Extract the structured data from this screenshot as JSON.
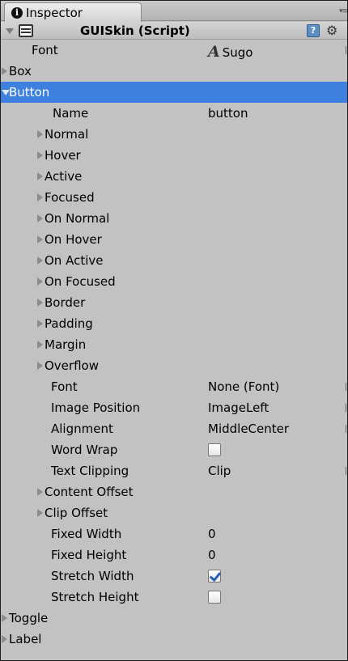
{
  "tab": {
    "label": "Inspector"
  },
  "header": {
    "title": "GUISkin (Script)"
  },
  "font": {
    "label": "Font",
    "value": "Sugo"
  },
  "sections": {
    "box": "Box",
    "button": "Button",
    "toggle": "Toggle",
    "label": "Label"
  },
  "button": {
    "name_label": "Name",
    "name_value": "button",
    "states": [
      "Normal",
      "Hover",
      "Active",
      "Focused",
      "On Normal",
      "On Hover",
      "On Active",
      "On Focused",
      "Border",
      "Padding",
      "Margin",
      "Overflow"
    ],
    "font_label": "Font",
    "font_value": "None (Font)",
    "image_position_label": "Image Position",
    "image_position_value": "ImageLeft",
    "alignment_label": "Alignment",
    "alignment_value": "MiddleCenter",
    "word_wrap_label": "Word Wrap",
    "word_wrap_checked": false,
    "text_clipping_label": "Text Clipping",
    "text_clipping_value": "Clip",
    "content_offset_label": "Content Offset",
    "clip_offset_label": "Clip Offset",
    "fixed_width_label": "Fixed Width",
    "fixed_width_value": "0",
    "fixed_height_label": "Fixed Height",
    "fixed_height_value": "0",
    "stretch_width_label": "Stretch Width",
    "stretch_width_checked": true,
    "stretch_height_label": "Stretch Height",
    "stretch_height_checked": false
  },
  "colors": {
    "selection": "#3d80df",
    "panel": "#c2c2c2"
  }
}
